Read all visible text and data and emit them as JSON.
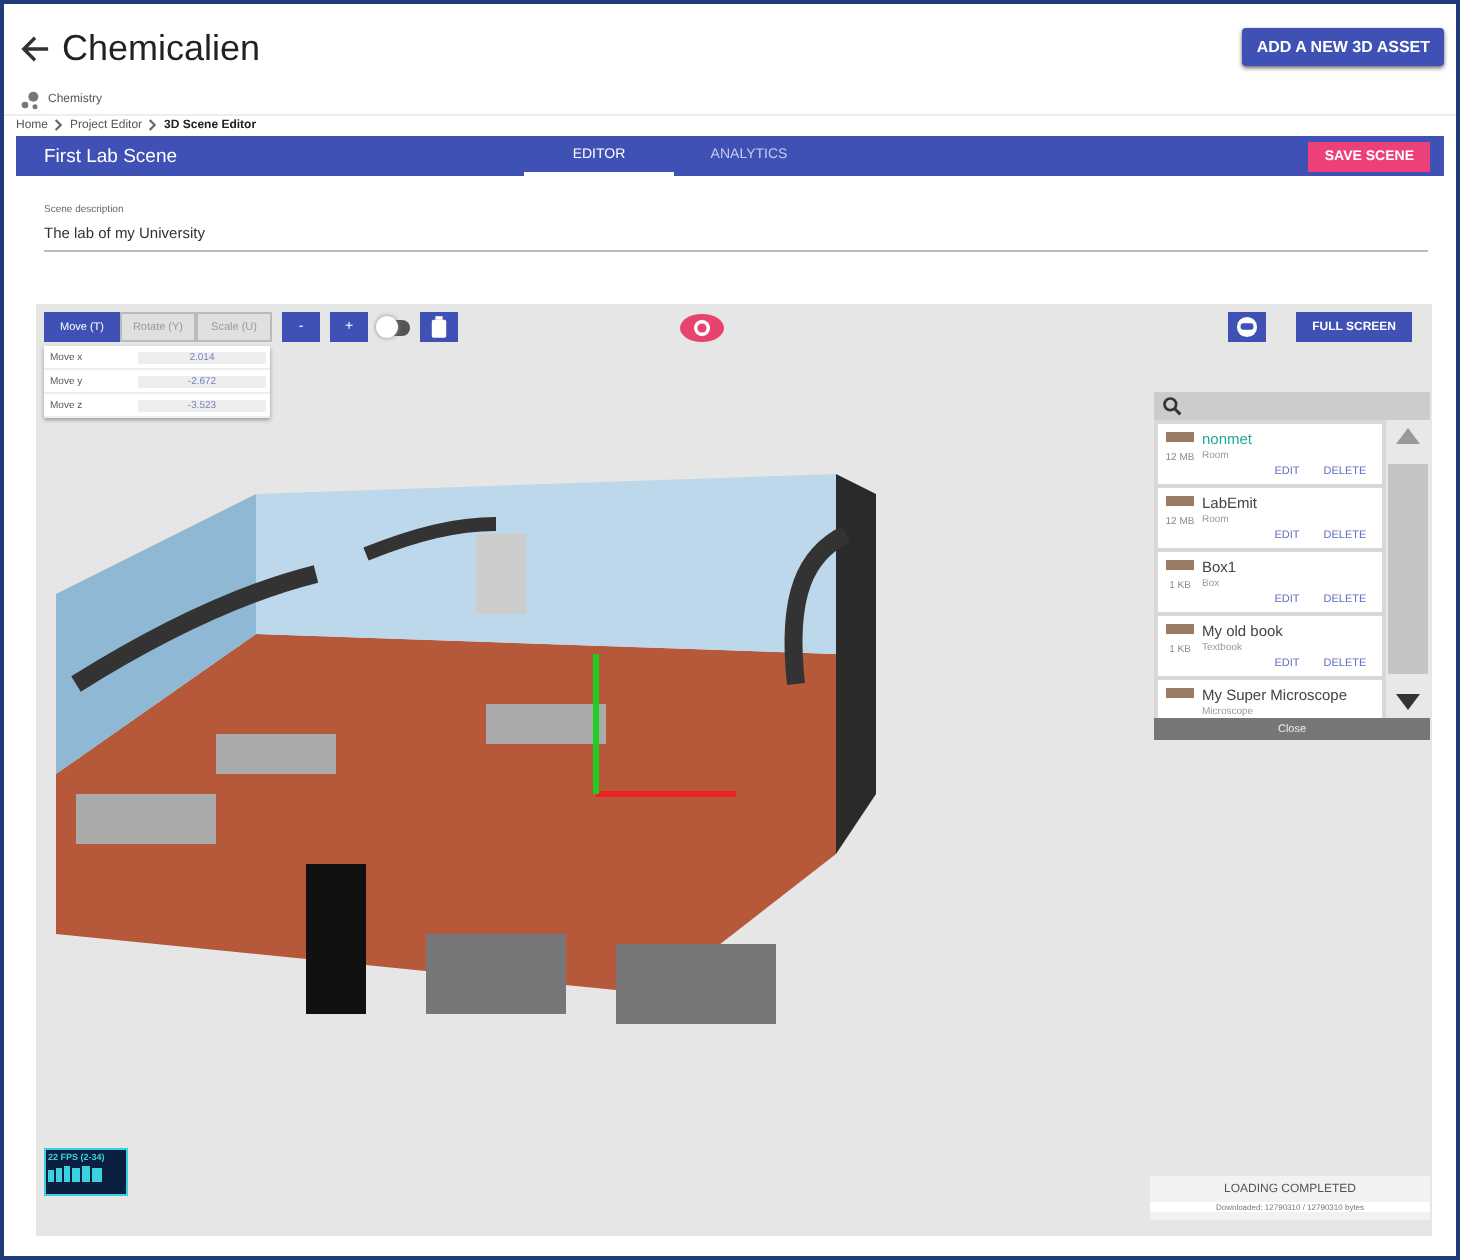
{
  "header": {
    "title": "Chemicalien",
    "add_button": "ADD A NEW 3D ASSET",
    "project": "Chemistry"
  },
  "breadcrumb": [
    {
      "label": "Home",
      "current": false
    },
    {
      "label": "Project Editor",
      "current": false
    },
    {
      "label": "3D Scene Editor",
      "current": true
    }
  ],
  "scene_bar": {
    "title": "First Lab Scene",
    "tabs": [
      {
        "label": "EDITOR",
        "selected": true
      },
      {
        "label": "ANALYTICS",
        "selected": false
      }
    ],
    "save_button": "SAVE SCENE"
  },
  "description": {
    "label": "Scene description",
    "value": "The lab of my University"
  },
  "toolbar": {
    "modes": [
      {
        "label": "Move (T)",
        "selected": true
      },
      {
        "label": "Rotate (Y)",
        "selected": false
      },
      {
        "label": "Scale (U)",
        "selected": false
      }
    ],
    "zoom_out": "-",
    "zoom_in": "+",
    "toggle_on": false,
    "full_screen": "FULL SCREEN"
  },
  "transform": [
    {
      "label": "Move x",
      "value": "2.014"
    },
    {
      "label": "Move y",
      "value": "-2.672"
    },
    {
      "label": "Move z",
      "value": "-3.523"
    }
  ],
  "assets": [
    {
      "name": "nonmet",
      "type": "Room",
      "size": "12 MB",
      "selected": true,
      "edit": "EDIT",
      "delete": "DELETE"
    },
    {
      "name": "LabEmit",
      "type": "Room",
      "size": "12 MB",
      "selected": false,
      "edit": "EDIT",
      "delete": "DELETE"
    },
    {
      "name": "Box1",
      "type": "Box",
      "size": "1 KB",
      "selected": false,
      "edit": "EDIT",
      "delete": "DELETE"
    },
    {
      "name": "My old book",
      "type": "Textbook",
      "size": "1 KB",
      "selected": false,
      "edit": "EDIT",
      "delete": "DELETE"
    },
    {
      "name": "My Super Microscope",
      "type": "Microscope",
      "selected": false
    }
  ],
  "close": "Close",
  "fps": "22 FPS (2-34)",
  "loading": {
    "title": "LOADING COMPLETED",
    "detail": "Downloaded: 12790310 / 12790310 bytes"
  }
}
